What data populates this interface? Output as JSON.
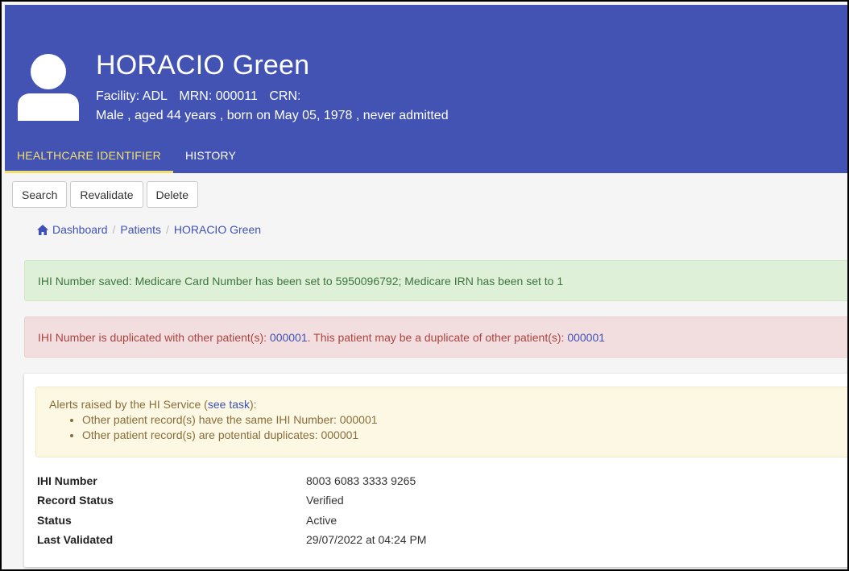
{
  "patient": {
    "name": "HORACIO Green",
    "facility": "Facility: ADL",
    "mrn": "MRN: 000011",
    "crn": "CRN:",
    "summary": "Male , aged 44 years , born on May 05, 1978 , never admitted"
  },
  "tabs": [
    {
      "label": "HEALTHCARE IDENTIFIER",
      "active": true
    },
    {
      "label": "HISTORY",
      "active": false
    }
  ],
  "toolbar": {
    "search_label": "Search",
    "revalidate_label": "Revalidate",
    "delete_label": "Delete"
  },
  "breadcrumb": {
    "dashboard": "Dashboard",
    "patients": "Patients",
    "current": "HORACIO Green",
    "separator": "/"
  },
  "alerts": {
    "success": "IHI Number saved: Medicare Card Number has been set to 5950096792; Medicare IRN has been set to 1",
    "danger_part1": "IHI Number is duplicated with other patient(s): ",
    "danger_link1": "000001",
    "danger_part2": ". This patient may be a duplicate of other patient(s): ",
    "danger_link2": "000001"
  },
  "hi_service": {
    "intro": "Alerts raised by the HI Service (",
    "link": "see task",
    "intro_end": "):",
    "items": [
      "Other patient record(s) have the same IHI Number: 000001",
      "Other patient record(s) are potential duplicates: 000001"
    ]
  },
  "details": [
    {
      "label": "IHI Number",
      "value": "8003 6083 3333 9265"
    },
    {
      "label": "Record Status",
      "value": "Verified"
    },
    {
      "label": "Status",
      "value": "Active"
    },
    {
      "label": "Last Validated",
      "value": "29/07/2022 at 04:24 PM"
    }
  ],
  "colors": {
    "header": "#4253b4",
    "active_tab": "#f3df6d",
    "link": "#3f51b5",
    "success_bg": "#dff0d8",
    "danger_bg": "#f2dede",
    "warning_bg": "#fcf8e3"
  },
  "icons": {
    "avatar": "user-avatar-icon",
    "home": "home-icon"
  }
}
